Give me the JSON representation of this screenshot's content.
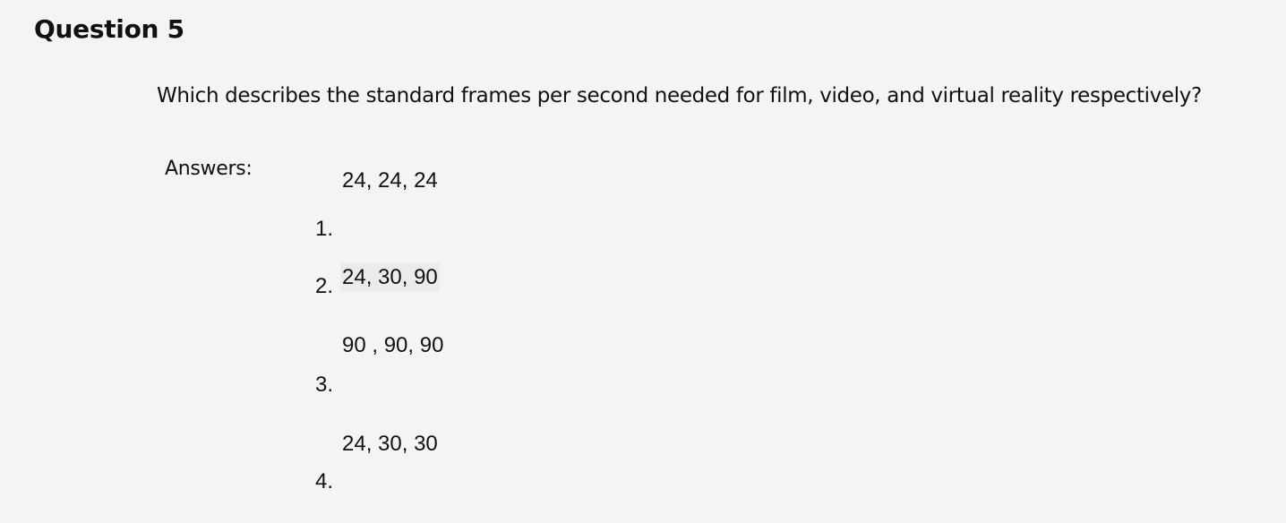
{
  "question": {
    "title": "Question 5",
    "text": "Which describes the standard frames per second needed for film, video, and virtual reality respectively?"
  },
  "answers": {
    "label": "Answers:",
    "options": [
      {
        "number": "1.",
        "text": "24, 24, 24"
      },
      {
        "number": "2.",
        "text": "24, 30, 90"
      },
      {
        "number": "3.",
        "text": "90 , 90, 90"
      },
      {
        "number": "4.",
        "text": "24, 30, 30"
      }
    ]
  }
}
